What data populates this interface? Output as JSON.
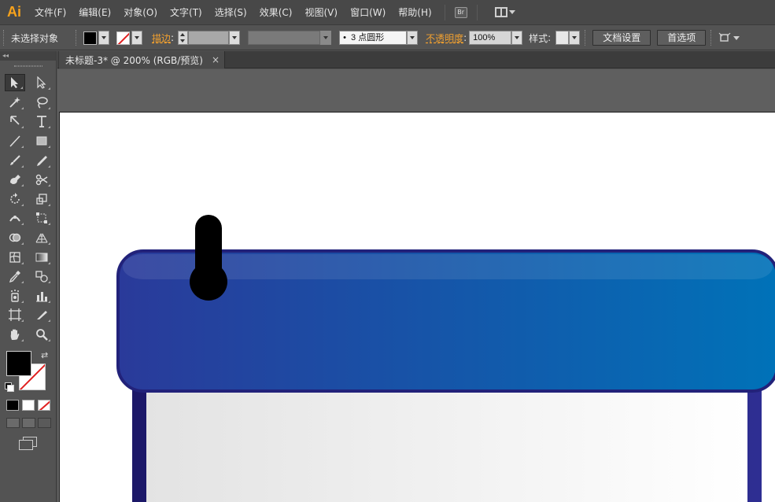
{
  "app": {
    "logo": "Ai",
    "logo_color": "#f7a21b"
  },
  "menu": [
    "文件(F)",
    "编辑(E)",
    "对象(O)",
    "文字(T)",
    "选择(S)",
    "效果(C)",
    "视图(V)",
    "窗口(W)",
    "帮助(H)"
  ],
  "menu_extras": {
    "bridge": "Br"
  },
  "control": {
    "selection_label": "未选择对象",
    "fill_color": "#000000",
    "stroke_label": "描边",
    "brush_value": "3 点圆形",
    "opacity_label": "不透明度",
    "opacity_value": "100%",
    "style_label": "样式",
    "doc_setup_button": "文档设置",
    "preferences_button": "首选项",
    "accent_color": "#f0a030"
  },
  "document": {
    "tab_title": "未标题-3* @ 200% (RGB/预览)",
    "close_glyph": "×"
  },
  "tools": [
    [
      "selection-tool",
      "direct-selection-tool"
    ],
    [
      "magic-wand-tool",
      "lasso-tool"
    ],
    [
      "pen-tool",
      "type-tool"
    ],
    [
      "line-segment-tool",
      "rectangle-tool"
    ],
    [
      "paintbrush-tool",
      "pencil-tool"
    ],
    [
      "blob-brush-tool",
      "scissors-tool"
    ],
    [
      "rotate-tool",
      "scale-tool"
    ],
    [
      "width-tool",
      "free-transform-tool"
    ],
    [
      "shape-builder-tool",
      "perspective-grid-tool"
    ],
    [
      "mesh-tool",
      "gradient-tool"
    ],
    [
      "eyedropper-tool",
      "blend-tool"
    ],
    [
      "symbol-sprayer-tool",
      "column-graph-tool"
    ],
    [
      "artboard-tool",
      "slice-tool"
    ],
    [
      "hand-tool",
      "zoom-tool"
    ]
  ],
  "artwork": {
    "header_gradient": [
      "#2a3a9a",
      "#0072b8"
    ],
    "border_color": "#222277",
    "peg_color": "#000000"
  }
}
